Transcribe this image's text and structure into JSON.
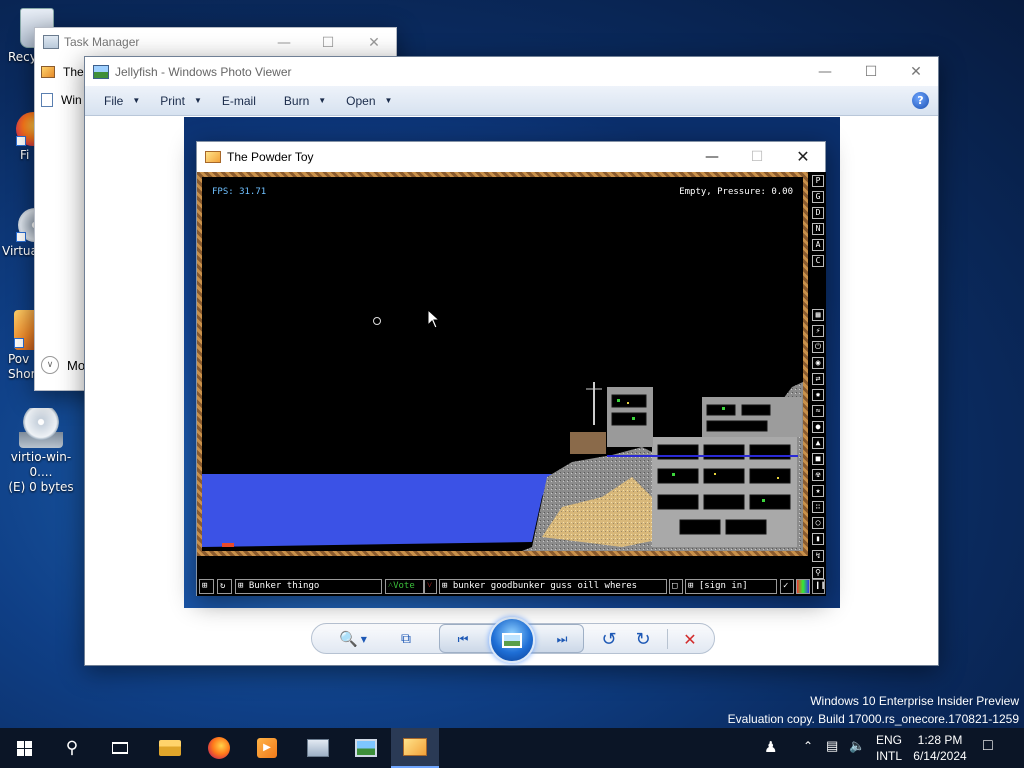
{
  "desktop": {
    "icons": [
      {
        "label": "Recy"
      },
      {
        "label": "Fi"
      },
      {
        "label": "Virtua"
      },
      {
        "label": "Pov\nShort"
      },
      {
        "label": "virtio-win-0....\n(E) 0 bytes"
      }
    ],
    "watermark": {
      "line1": "Windows 10 Enterprise Insider Preview",
      "line2": "Evaluation copy. Build 17000.rs_onecore.170821-1259"
    }
  },
  "task_manager": {
    "title": "Task Manager",
    "items": [
      "The",
      "Win"
    ],
    "more_label": "Mo"
  },
  "photo_viewer": {
    "title": "Jellyfish - Windows Photo Viewer",
    "menu": [
      {
        "label": "File",
        "has_caret": true
      },
      {
        "label": "Print",
        "has_caret": true
      },
      {
        "label": "E-mail",
        "has_caret": false
      },
      {
        "label": "Burn",
        "has_caret": true
      },
      {
        "label": "Open",
        "has_caret": true
      }
    ],
    "controls": {
      "zoom_icon": "zoom-icon",
      "fit_icon": "actual-size-icon",
      "prev_icon": "previous-icon",
      "slideshow_icon": "slideshow-icon",
      "next_icon": "next-icon",
      "rotate_ccw_icon": "rotate-ccw-icon",
      "rotate_cw_icon": "rotate-cw-icon",
      "delete_icon": "delete-icon"
    }
  },
  "powder_toy": {
    "title": "The Powder Toy",
    "fps": "FPS: 31.71",
    "status": "Empty, Pressure: 0.00",
    "side_letters": [
      "P",
      "G",
      "D",
      "N",
      "A",
      "C"
    ],
    "bottom": {
      "save_name": "Bunker thingo",
      "vote": "Vote",
      "tags": "bunker goodbunker guss oill wheres",
      "sign_in": "[sign in]"
    }
  },
  "taskbar": {
    "lang_top": "ENG",
    "lang_bottom": "INTL",
    "time": "1:28 PM",
    "date": "6/14/2024"
  },
  "colors": {
    "accent": "#1d58b5",
    "water": "#3b52e6",
    "border_brown": "#8a5b2e",
    "close_red": "#d22c2c"
  }
}
